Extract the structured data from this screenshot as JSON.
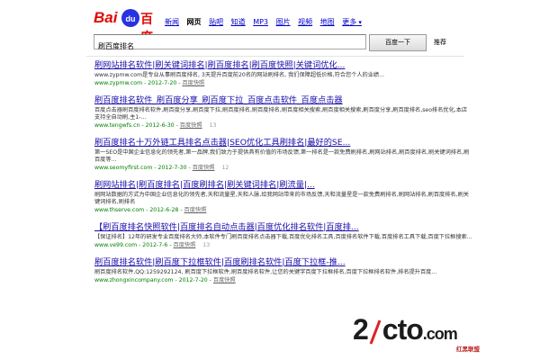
{
  "logo": {
    "latin": "Bai",
    "paw": "du",
    "cn": "百度"
  },
  "nav": {
    "items": [
      "新闻",
      "网页",
      "贴吧",
      "知道",
      "MP3",
      "图片",
      "视频",
      "地图",
      "更多"
    ],
    "active_index": 1
  },
  "search": {
    "query": "刷百度排名",
    "button_label": "百度一下",
    "aside_label": "推荐"
  },
  "results": [
    {
      "title": "刷网站排名软件|刷关键词排名|刷百度排名|刷百度快照|关键词优化...",
      "snippet": "www.zypmw.com是专业从事刷百度排名, 3天提升百度前20名的网站刷排名, 我们保障超低价格,符合您个人的业绩...",
      "url": "www.zypmw.com",
      "date": "2012-7-20",
      "snapshot": "百度快照",
      "count": ""
    },
    {
      "title": "刷百度排名软件_刷百度分享_刷百度下拉_百度点击软件_百度点击器",
      "snippet": "百度点击器刷百度排名软件,刷百度分享,刷百度下拉,刷百度排名,刷百度排名,刷百度相关搜索,刷百度相关搜索,刷百度分享,刷百度排名,seo排名优化,本店支持全自动刷,主1-...",
      "url": "www.tengwfs.cn",
      "date": "2012-6-30",
      "snapshot": "百度快照",
      "count": "13"
    },
    {
      "title": "刷百度排名十万外链工具排名点击器|SEO优化工具刷排名|最好的SE...",
      "snippet": "第一SEO是中国企业信息化的领先者,第一品牌,我们致力于提供具有价值的市场反馈,第一排名是一款免费刷排名,刷网站排名,刷百度排名,刷关键词排名,刷百度等...",
      "url": "www.seomyfirst.com",
      "date": "2012-7-30",
      "snapshot": "百度快照",
      "count": "12"
    },
    {
      "title": "刷网站排名|刷百度排名|百度刷排名|刷关键词排名|刷流量|...",
      "snippet": "刷网站数据的方式为中国企业信息化的领先者,天和流量星,天和人脉,给我网站带来的市场反馈,天和流量星是一款免费刷排名,刷网站排名,刷百度排名,刷关键词排名,刷排名",
      "url": "www.thserve.com",
      "date": "2012-6-28",
      "snapshot": "百度快照",
      "count": ""
    },
    {
      "title": "【刷百度排名快照软件|百度排名自动点击器|百度优化排名软件|百度排...",
      "snippet": "【保证排名】12年的研发专业百度排名大师,本软件专门刷百度排名点击器下载,百度优化排名工具,百度排名软件下载,百度排名工具下载,百度下拉框搜索...",
      "url": "www.ve99.com",
      "date": "2012-7-6",
      "snapshot": "百度快照",
      "count": "13"
    },
    {
      "title": "刷百度排名软件|刷百度下拉框软件|百度刷排名软件|百度下拉框-推...",
      "snippet": "刷百度排名软件,QQ:1259292124, 刷百度下拉框软件,刷百度排名软件,让您的关键字百度下拉框排名,百度下拉框排名软件,排名提升百度...",
      "url": "www.zhongxincompany.com",
      "date": "2012-7-20",
      "snapshot": "百度快照",
      "count": ""
    }
  ],
  "watermark": {
    "main_a": "2",
    "main_b": "cto",
    "main_c": ".com",
    "sub": "红黑联盟"
  }
}
